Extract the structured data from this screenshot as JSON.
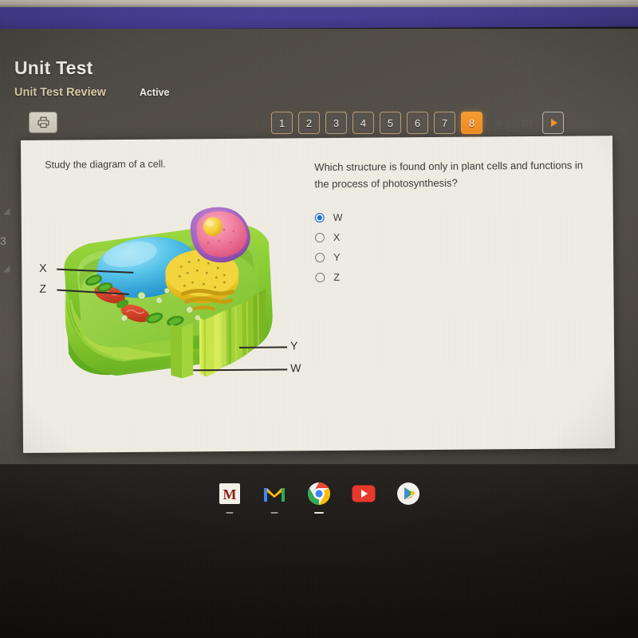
{
  "browser": {
    "bar_color": "#473d92"
  },
  "header": {
    "title": "Unit Test",
    "tab_active": "Unit Test Review",
    "status": "Active",
    "print_icon": "printer-icon"
  },
  "pagination": {
    "items": [
      {
        "label": "1",
        "state": "enabled"
      },
      {
        "label": "2",
        "state": "enabled"
      },
      {
        "label": "3",
        "state": "enabled"
      },
      {
        "label": "4",
        "state": "enabled"
      },
      {
        "label": "5",
        "state": "enabled"
      },
      {
        "label": "6",
        "state": "enabled"
      },
      {
        "label": "7",
        "state": "enabled"
      },
      {
        "label": "8",
        "state": "current"
      },
      {
        "label": "9",
        "state": "disabled"
      },
      {
        "label": "10",
        "state": "disabled"
      }
    ],
    "next_icon": "next-arrow-icon",
    "current_color": "#f0922b"
  },
  "content": {
    "stem": "Study the diagram of a cell.",
    "question": "Which structure is found only in plant cells and functions in the process of photosynthesis?",
    "options": [
      {
        "label": "W",
        "selected": true
      },
      {
        "label": "X",
        "selected": false
      },
      {
        "label": "Y",
        "selected": false
      },
      {
        "label": "Z",
        "selected": false
      }
    ],
    "selected_answer": "W",
    "diagram": {
      "alt": "plant-cell-diagram",
      "labels": [
        {
          "text": "X",
          "side": "left"
        },
        {
          "text": "Z",
          "side": "left"
        },
        {
          "text": "Y",
          "side": "right"
        },
        {
          "text": "W",
          "side": "right"
        }
      ]
    }
  },
  "shelf": {
    "items": [
      {
        "name": "umn-app-icon",
        "label": "M"
      },
      {
        "name": "gmail-icon",
        "label": "M"
      },
      {
        "name": "chrome-icon",
        "label": ""
      },
      {
        "name": "youtube-icon",
        "label": ""
      },
      {
        "name": "play-store-icon",
        "label": ""
      }
    ]
  }
}
